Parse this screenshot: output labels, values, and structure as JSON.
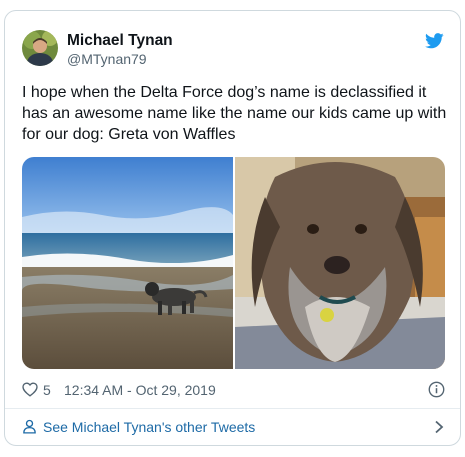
{
  "tweet": {
    "author_name": "Michael Tynan",
    "author_handle": "@MTynan79",
    "text": "I hope when the Delta Force dog’s name is declassified it has an awesome name like the name our kids came up with for our dog: Greta von Waffles",
    "likes": "5",
    "timestamp": "12:34 AM - Oct 29, 2019",
    "footer_link": "See Michael Tynan's other Tweets"
  },
  "icons": {
    "brand": "twitter-bird-icon",
    "like": "heart-icon",
    "info": "info-icon",
    "profile": "person-icon",
    "more": "chevron-right-icon"
  },
  "colors": {
    "brand_blue": "#1d9bf0",
    "link_blue": "#1d6aa6",
    "secondary_text": "#536471",
    "border": "#cfd9de"
  }
}
